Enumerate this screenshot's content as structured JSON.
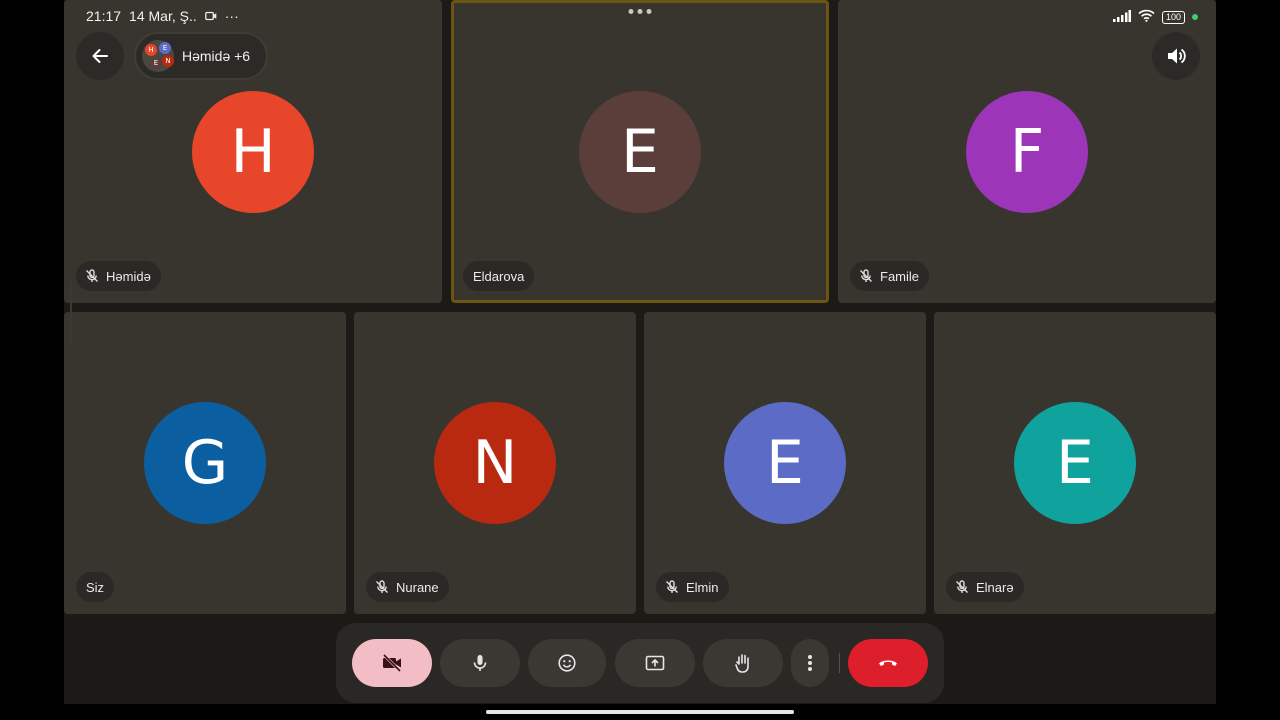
{
  "status_bar": {
    "time": "21:17",
    "date": "14 Mar, Ş..",
    "more": "···",
    "battery": "100"
  },
  "header": {
    "call_title": "Həmidə +6",
    "mini_avatar_letters": [
      "H",
      "E",
      "E",
      "N"
    ]
  },
  "participants": [
    {
      "name": "Həmidə",
      "initial": "H",
      "color": "#e8462a",
      "muted": true
    },
    {
      "name": "Eldarova",
      "initial": "E",
      "color": "#5b3e3a",
      "muted": false,
      "active_speaker": true
    },
    {
      "name": "Famile",
      "initial": "F",
      "color": "#9c35b8",
      "muted": true
    },
    {
      "name": "Siz",
      "initial": "G",
      "color": "#0b5fa1",
      "muted": false
    },
    {
      "name": "Nurane",
      "initial": "N",
      "color": "#b8290f",
      "muted": true
    },
    {
      "name": "Elmin",
      "initial": "E",
      "color": "#5c6cc6",
      "muted": true
    },
    {
      "name": "Elnarə",
      "initial": "E",
      "color": "#10a39d",
      "muted": true
    }
  ],
  "toolbar": {
    "camera_state": "off",
    "camera_color": "#f2bdc4",
    "end_call_color": "#dc1f2a"
  },
  "colors": {
    "background": "#1c1a16",
    "tile": "#38352f",
    "active_border": "#6b5510"
  }
}
